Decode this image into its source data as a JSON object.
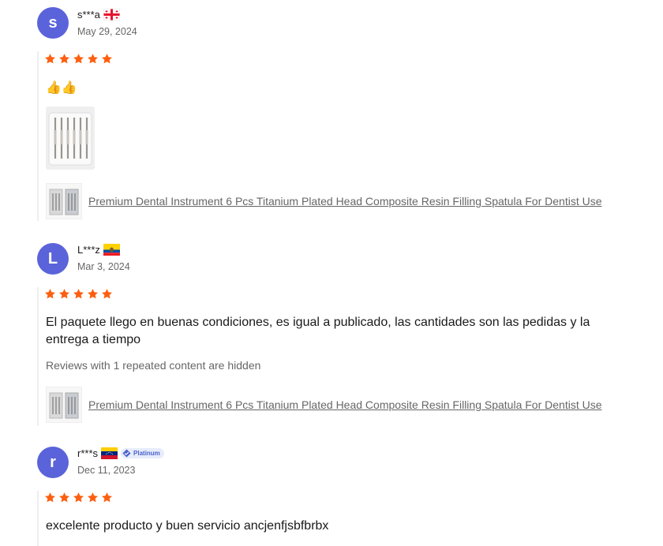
{
  "reviews": [
    {
      "avatar_letter": "s",
      "user": "s***a",
      "flag": "georgia-flag",
      "date": "May 29, 2024",
      "rating": 5,
      "text": "👍👍",
      "product_link": "Premium Dental Instrument 6 Pcs Titanium Plated Head Composite Resin Filling Spatula For Dentist Use"
    },
    {
      "avatar_letter": "L",
      "user": "L***z",
      "flag": "ecuador-flag",
      "date": "Mar 3, 2024",
      "rating": 5,
      "text_line1": "El paquete llego en buenas condiciones, es igual a publicado, las cantidades son las pedidas y la",
      "text_line2": "entrega a tiempo",
      "hidden_note": "Reviews with 1 repeated content are hidden",
      "product_link": "Premium Dental Instrument 6 Pcs Titanium Plated Head Composite Resin Filling Spatula For Dentist Use"
    },
    {
      "avatar_letter": "r",
      "user": "r***s",
      "flag": "venezuela-flag",
      "badge": "Platinum",
      "date": "Dec 11, 2023",
      "rating": 5,
      "text": "excelente producto y buen servicio ancjenfjsbfbrbx"
    }
  ],
  "colors": {
    "avatar": "#5a63d9",
    "star": "#fd5f10",
    "link": "#666666"
  }
}
